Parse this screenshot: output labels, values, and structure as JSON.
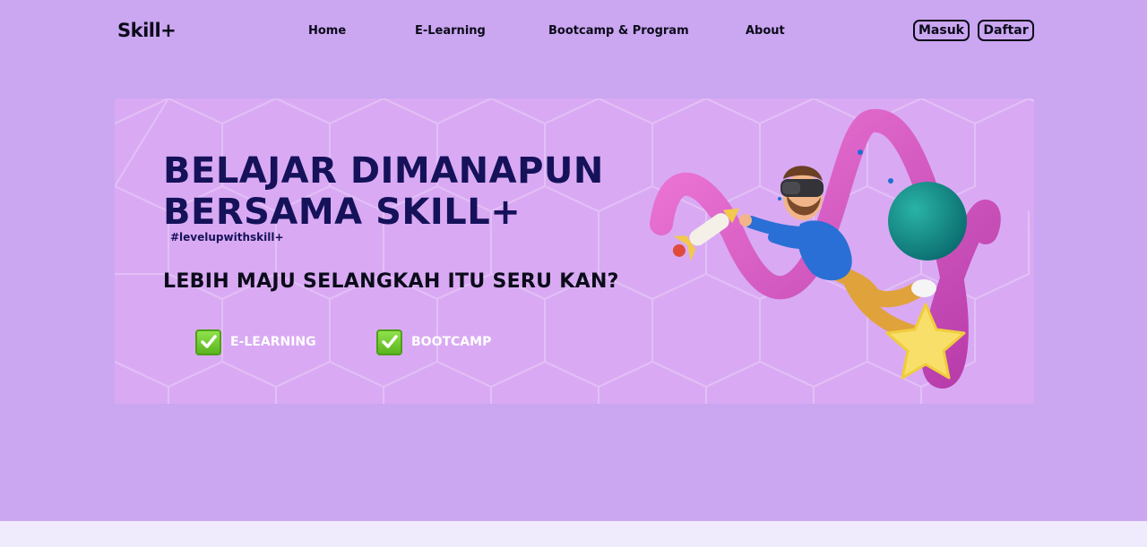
{
  "nav": {
    "logo": "Skill+",
    "links": [
      "Home",
      "E-Learning",
      "Bootcamp & Program",
      "About"
    ],
    "login_label": "Masuk",
    "register_label": "Daftar"
  },
  "hero": {
    "title_line1": "BELAJAR DIMANAPUN",
    "title_line2": "BERSAMA SKILL+",
    "hashtag": "#levelupwithskill+",
    "subtitle": "LEBIH MAJU SELANGKAH ITU SERU KAN?",
    "features": [
      "E-LEARNING",
      "BOOTCAMP"
    ]
  },
  "colors": {
    "page_background": "#cba6f1",
    "hero_background": "#d9aaf3",
    "title": "#15125a",
    "check_green": "#6cc72a"
  }
}
